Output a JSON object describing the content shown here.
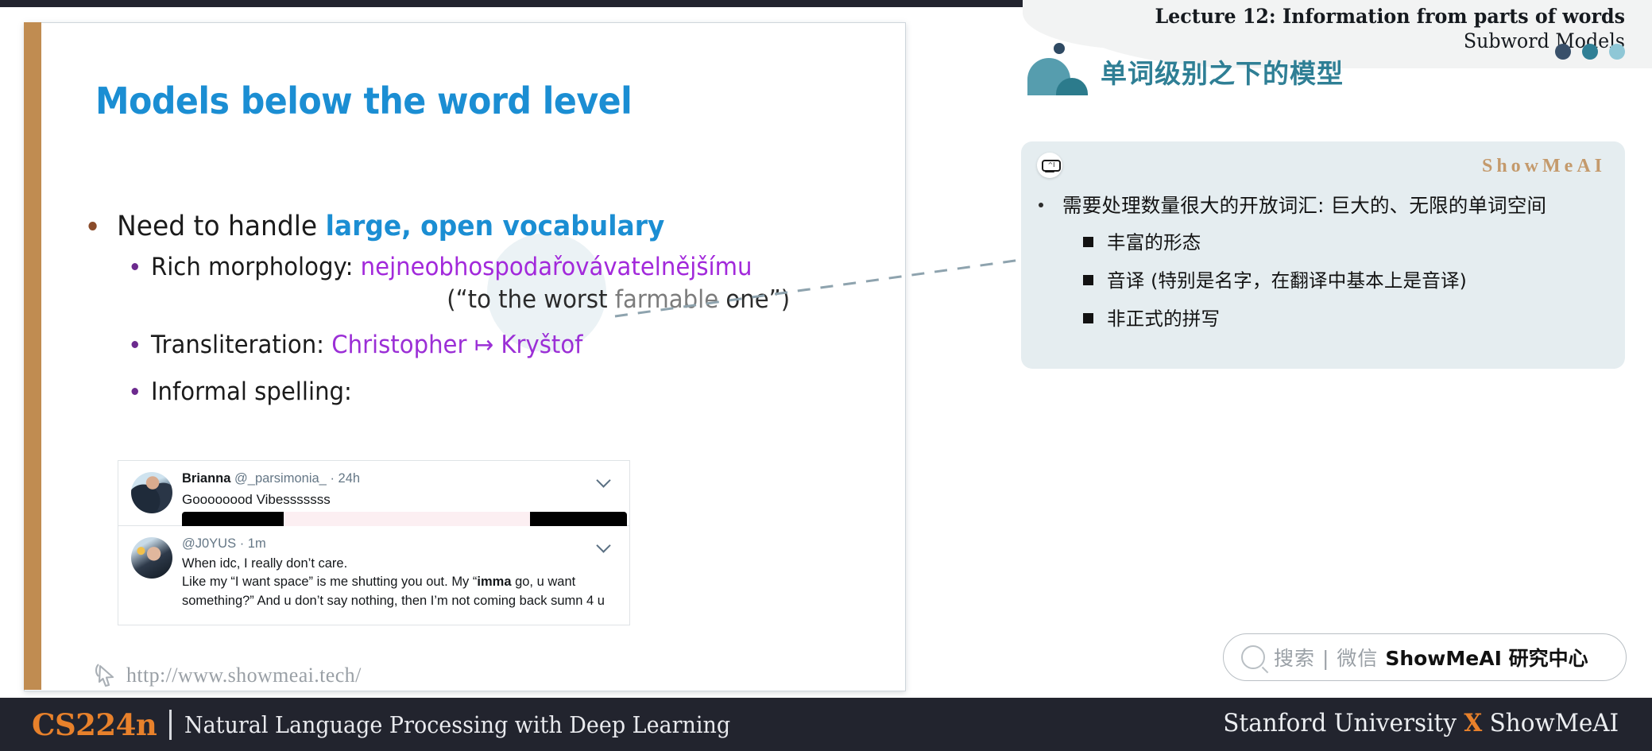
{
  "header": {
    "lecture_title": "Lecture 12: Information from parts of words",
    "lecture_subtitle": "Subword Models",
    "cn_title": "单词级别之下的模型"
  },
  "slide": {
    "title": "Models below the word level",
    "bullet_main_pre": "Need to handle ",
    "bullet_main_hl": "large, open vocabulary",
    "sub1_label": "Rich morphology: ",
    "sub1_value": "nejneobhospodařovávatelnějšímu",
    "sub1_gloss_pre": "(“to the worst ",
    "sub1_gloss_grey": "farmable",
    "sub1_gloss_post": " one”)",
    "sub2_label": "Transliteration: ",
    "sub2_value": "Christopher ↦ Kryštof",
    "sub3_label": "Informal spelling:",
    "watermark_url": "http://www.showmeai.tech/"
  },
  "tweets": [
    {
      "name": "Brianna",
      "handle": "@_parsimonia_",
      "time": "24h",
      "body": "Goooooood Vibesssssss",
      "redacted": true
    },
    {
      "name": "",
      "handle": "@J0YUS",
      "time": "1m",
      "body_line1": "When idc, I really don’t care.",
      "body_line2_a": "Like my “I want space” is me shutting you out. My “",
      "body_line2_b": "imma",
      "body_line2_c": " go, u want",
      "body_line3": "something?” And u don’t say nothing, then I’m not coming back sumn 4 u"
    }
  ],
  "card": {
    "brand": "ShowMeAI",
    "bullet_main": "需要处理数量很大的开放词汇: 巨大的、无限的单词空间",
    "sub_bullets": [
      "丰富的形态",
      "音译 (特别是名字，在翻译中基本上是音译)",
      "非正式的拼写"
    ]
  },
  "search": {
    "grey_text": "搜索 | 微信",
    "bold_text": "ShowMeAI 研究中心"
  },
  "footer": {
    "course_code": "CS224n",
    "course_name": "Natural Language Processing with Deep Learning",
    "right_pre": "Stanford University ",
    "right_x": "X",
    "right_post": " ShowMeAI"
  },
  "colors": {
    "accent_bar": "#c08c51",
    "title_blue": "#1b8ed3",
    "purple": "#a229db",
    "teal": "#2f7f95",
    "orange": "#e8812b",
    "footer_bg": "#22242e",
    "card_bg": "#e5edf0"
  }
}
